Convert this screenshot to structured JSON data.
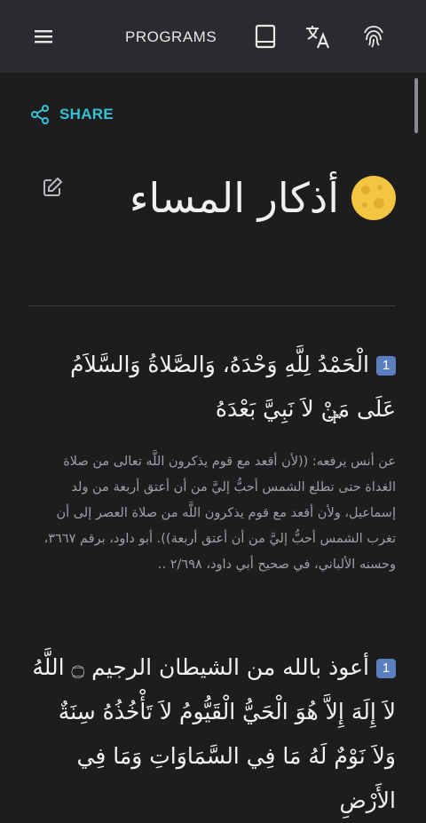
{
  "topbar": {
    "title": "PROGRAMS",
    "icons": [
      "menu-icon",
      "book-icon",
      "translate-icon",
      "fingerprint-icon"
    ]
  },
  "share": {
    "label": "SHARE",
    "color": "#36c1d3"
  },
  "page": {
    "title": "أذكار المساء"
  },
  "items": [
    {
      "number": "1",
      "text": "الْحَمْدُ لِلَّهِ وَحْدَهُ، وَالصَّلاةُ وَالسَّلاَمُ عَلَى مَنْ لاَ نَبِيَّ بَعْدَهُ",
      "source": "عن أنس يرفعه: ((لأن أقعد مع قوم يذكرون اللَّه تعالى من صلاة الغداة حتى تطلع الشمس أحبُّ إليَّ من أن أعتق أربعة من ولد إسماعيل، ولأن أقعد مع قوم يذكرون اللَّه من صلاة العصر إلى أن تغرب الشمس أحبُّ إليَّ من أن أعتق أربعة)). أبو داود، برقم ٣٦٦٧، وحسنه الألباني، في صحيح أبي داود، ٢/٦٩٨ .."
    },
    {
      "number": "1",
      "text": "أعوذ بالله من الشيطان الرجيم ۝ اللَّهُ لاَ إِلَهَ إِلاَّ هُوَ الْحَيُّ الْقَيُّومُ لاَ تَأْخُذُهُ سِنَةٌ وَلاَ نَوْمٌ لَهُ مَا فِي السَّمَاوَاتِ وَمَا فِي الأَرْضِ"
    }
  ]
}
